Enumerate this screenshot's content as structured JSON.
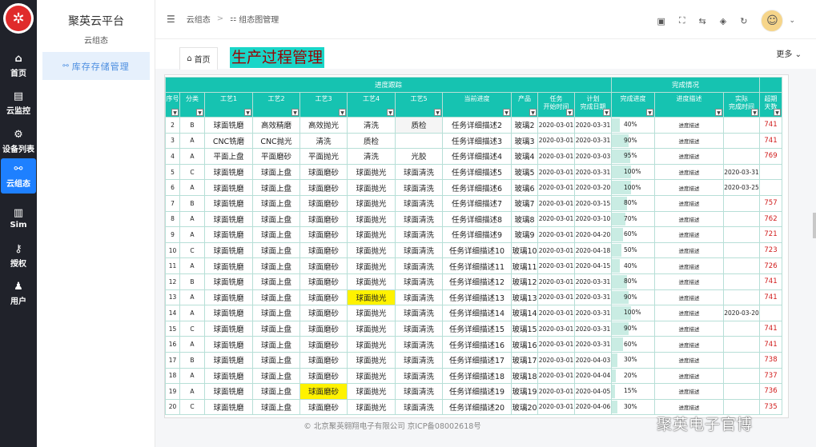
{
  "nav": {
    "items": [
      {
        "label": "首页",
        "icon": "home-icon",
        "glyph": "⌂"
      },
      {
        "label": "云监控",
        "icon": "monitor-icon",
        "glyph": "▤"
      },
      {
        "label": "设备列表",
        "icon": "gear-icon",
        "glyph": "⚙"
      },
      {
        "label": "云组态",
        "icon": "network-icon",
        "glyph": "⚯"
      },
      {
        "label": "Sim",
        "icon": "sim-icon",
        "glyph": "▥"
      },
      {
        "label": "授权",
        "icon": "key-icon",
        "glyph": "⚷"
      },
      {
        "label": "用户",
        "icon": "user-icon",
        "glyph": "♟"
      }
    ],
    "active_index": 3
  },
  "sidebar": {
    "title": "聚英云平台",
    "subtitle": "云组态",
    "menu_item": "库存存储管理"
  },
  "header": {
    "breadcrumb": [
      "云组态",
      "组态图管理"
    ],
    "more": "更多"
  },
  "tabs": {
    "home": "首页",
    "banner": "生产过程管理"
  },
  "table": {
    "group_headers": [
      {
        "label": "进度跟踪"
      },
      {
        "label": "完成情况"
      }
    ],
    "columns": [
      "序号",
      "分类",
      "工艺1",
      "工艺2",
      "工艺3",
      "工艺4",
      "工艺5",
      "当前进度",
      "产品",
      "任务\n开始时间",
      "计划\n完成日期",
      "完成进度",
      "进度描述",
      "实际\n完成时间",
      "超期\n天数"
    ],
    "rows": [
      [
        "2",
        "B",
        "球面铣磨",
        "高效精磨",
        "高效抛光",
        "清洗",
        "质检",
        "任务详细描述2",
        "玻璃2",
        "2020-03-01",
        "2020-03-31",
        "40%",
        "进度描述",
        "",
        "741"
      ],
      [
        "3",
        "A",
        "CNC铣磨",
        "CNC抛光",
        "清洗",
        "质检",
        "",
        "任务详细描述3",
        "玻璃3",
        "2020-03-01",
        "2020-03-31",
        "90%",
        "进度描述",
        "",
        "741"
      ],
      [
        "4",
        "A",
        "平面上盘",
        "平面磨砂",
        "平面抛光",
        "清洗",
        "光胶",
        "任务详细描述4",
        "玻璃4",
        "2020-03-01",
        "2020-03-03",
        "95%",
        "进度描述",
        "",
        "769"
      ],
      [
        "5",
        "C",
        "球面铣磨",
        "球面上盘",
        "球面磨砂",
        "球面抛光",
        "球面清洗",
        "任务详细描述5",
        "玻璃5",
        "2020-03-01",
        "2020-03-31",
        "100%",
        "进度描述",
        "2020-03-31",
        ""
      ],
      [
        "6",
        "A",
        "球面铣磨",
        "球面上盘",
        "球面磨砂",
        "球面抛光",
        "球面清洗",
        "任务详细描述6",
        "玻璃6",
        "2020-03-01",
        "2020-03-20",
        "100%",
        "进度描述",
        "2020-03-25",
        ""
      ],
      [
        "7",
        "B",
        "球面铣磨",
        "球面上盘",
        "球面磨砂",
        "球面抛光",
        "球面清洗",
        "任务详细描述7",
        "玻璃7",
        "2020-03-01",
        "2020-03-15",
        "80%",
        "进度描述",
        "",
        "757"
      ],
      [
        "8",
        "A",
        "球面铣磨",
        "球面上盘",
        "球面磨砂",
        "球面抛光",
        "球面清洗",
        "任务详细描述8",
        "玻璃8",
        "2020-03-01",
        "2020-03-10",
        "70%",
        "进度描述",
        "",
        "762"
      ],
      [
        "9",
        "A",
        "球面铣磨",
        "球面上盘",
        "球面磨砂",
        "球面抛光",
        "球面清洗",
        "任务详细描述9",
        "玻璃9",
        "2020-03-01",
        "2020-04-20",
        "60%",
        "进度描述",
        "",
        "721"
      ],
      [
        "10",
        "C",
        "球面铣磨",
        "球面上盘",
        "球面磨砂",
        "球面抛光",
        "球面清洗",
        "任务详细描述10",
        "玻璃10",
        "2020-03-01",
        "2020-04-18",
        "50%",
        "进度描述",
        "",
        "723"
      ],
      [
        "11",
        "A",
        "球面铣磨",
        "球面上盘",
        "球面磨砂",
        "球面抛光",
        "球面清洗",
        "任务详细描述11",
        "玻璃11",
        "2020-03-01",
        "2020-04-15",
        "40%",
        "进度描述",
        "",
        "726"
      ],
      [
        "12",
        "B",
        "球面铣磨",
        "球面上盘",
        "球面磨砂",
        "球面抛光",
        "球面清洗",
        "任务详细描述12",
        "玻璃12",
        "2020-03-01",
        "2020-03-31",
        "80%",
        "进度描述",
        "",
        "741"
      ],
      [
        "13",
        "A",
        "球面铣磨",
        "球面上盘",
        "球面磨砂",
        "球面抛光",
        "球面清洗",
        "任务详细描述13",
        "玻璃13",
        "2020-03-01",
        "2020-03-31",
        "90%",
        "进度描述",
        "",
        "741"
      ],
      [
        "14",
        "A",
        "球面铣磨",
        "球面上盘",
        "球面磨砂",
        "球面抛光",
        "球面清洗",
        "任务详细描述14",
        "玻璃14",
        "2020-03-01",
        "2020-03-31",
        "100%",
        "进度描述",
        "2020-03-20",
        ""
      ],
      [
        "15",
        "C",
        "球面铣磨",
        "球面上盘",
        "球面磨砂",
        "球面抛光",
        "球面清洗",
        "任务详细描述15",
        "玻璃15",
        "2020-03-01",
        "2020-03-31",
        "90%",
        "进度描述",
        "",
        "741"
      ],
      [
        "16",
        "A",
        "球面铣磨",
        "球面上盘",
        "球面磨砂",
        "球面抛光",
        "球面清洗",
        "任务详细描述16",
        "玻璃16",
        "2020-03-01",
        "2020-03-31",
        "60%",
        "进度描述",
        "",
        "741"
      ],
      [
        "17",
        "B",
        "球面铣磨",
        "球面上盘",
        "球面磨砂",
        "球面抛光",
        "球面清洗",
        "任务详细描述17",
        "玻璃17",
        "2020-03-01",
        "2020-04-03",
        "30%",
        "进度描述",
        "",
        "738"
      ],
      [
        "18",
        "A",
        "球面铣磨",
        "球面上盘",
        "球面磨砂",
        "球面抛光",
        "球面清洗",
        "任务详细描述18",
        "玻璃18",
        "2020-03-01",
        "2020-04-04",
        "20%",
        "进度描述",
        "",
        "737"
      ],
      [
        "19",
        "A",
        "球面铣磨",
        "球面上盘",
        "球面磨砂",
        "球面抛光",
        "球面清洗",
        "任务详细描述19",
        "玻璃19",
        "2020-03-01",
        "2020-04-05",
        "15%",
        "进度描述",
        "",
        "736"
      ],
      [
        "20",
        "C",
        "球面铣磨",
        "球面上盘",
        "球面磨砂",
        "球面抛光",
        "球面清洗",
        "任务详细描述20",
        "玻璃20",
        "2020-03-01",
        "2020-04-06",
        "30%",
        "进度描述",
        "",
        "735"
      ]
    ],
    "highlights": [
      {
        "row": 11,
        "col": 5
      },
      {
        "row": 17,
        "col": 4
      }
    ]
  },
  "footer": "© 北京聚英翱翔电子有限公司  京ICP备08002618号",
  "watermark": "聚英电子官博",
  "colors": {
    "nav_bg": "#20222a",
    "accent": "#1e80ff",
    "table_header": "#16c3b1",
    "overdue": "#d01a1a",
    "highlight": "#fff200",
    "banner_bg": "#19d6c8",
    "banner_text": "#9a0000"
  }
}
